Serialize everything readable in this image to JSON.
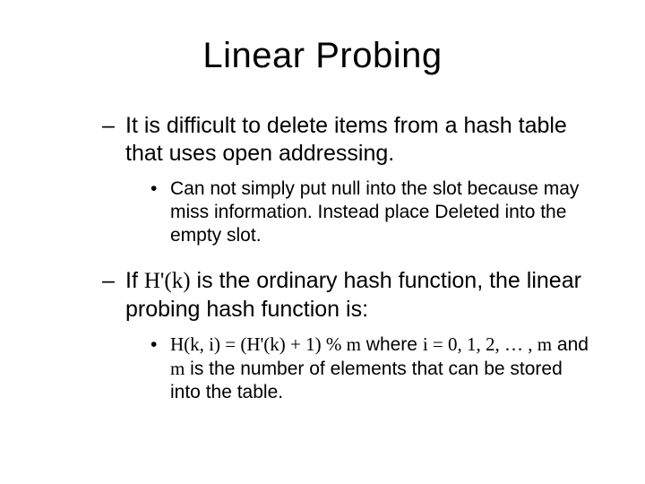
{
  "title": "Linear Probing",
  "points": {
    "p1": {
      "dash": "–",
      "text": "It is difficult to delete items from a hash table that uses open addressing."
    },
    "p1a": {
      "bullet": "•",
      "text": "Can not simply put null into the slot because may miss information.  Instead place Deleted into the empty slot."
    },
    "p2": {
      "dash": "–",
      "prefix": "If ",
      "hk": "H'(k)",
      "suffix": " is the ordinary hash function, the linear probing hash function is:"
    },
    "p2a": {
      "bullet": "•",
      "formula": "H(k, i) = (H'(k) + 1) % m",
      "mid1": " where ",
      "iseq": "i = 0, 1, 2, … , m",
      "mid2": " and ",
      "mvar": "m",
      "tail": " is the number of elements that can be stored into the table."
    }
  }
}
